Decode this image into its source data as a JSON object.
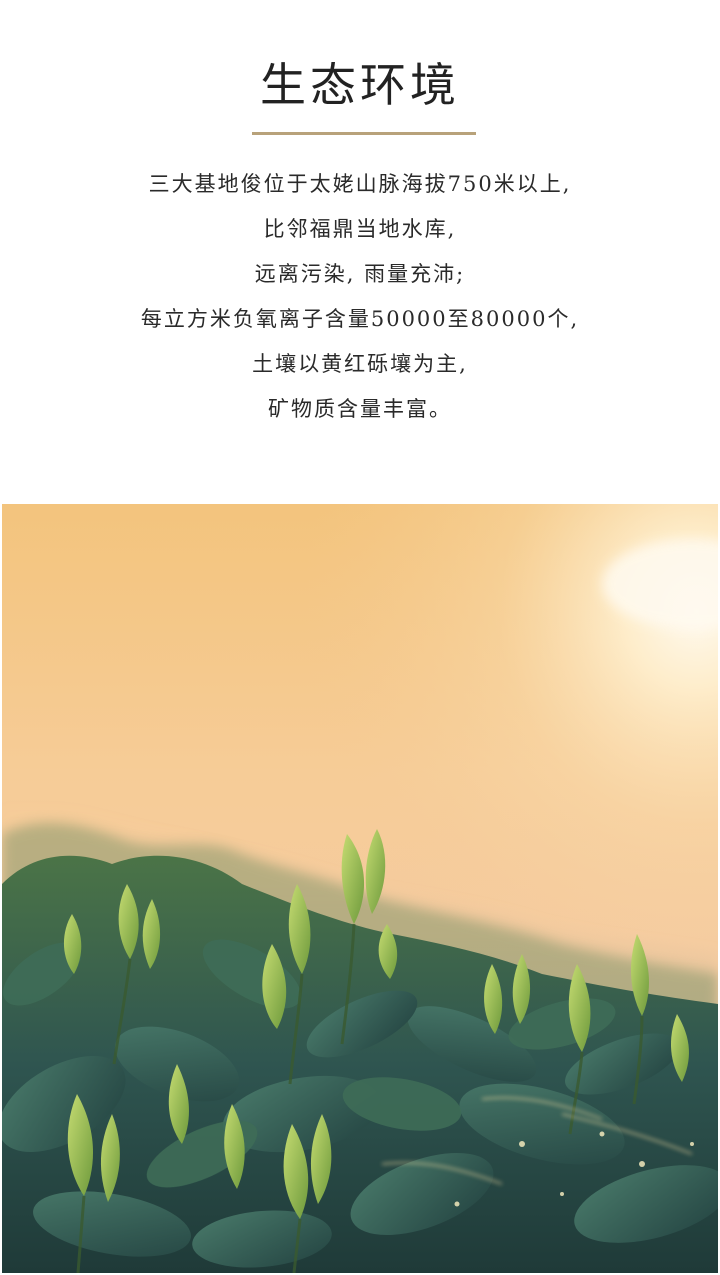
{
  "section": {
    "title": "生态环境",
    "lines": [
      "三大基地俊位于太姥山脉海拔750米以上,",
      "比邻福鼎当地水库,",
      "远离污染, 雨量充沛;",
      "每立方米负氧离子含量50000至80000个,",
      "土壤以黄红砾壤为主,",
      "矿物质含量丰富。"
    ]
  },
  "photo": {
    "subject": "tea-bushes-at-sunrise",
    "colors": {
      "sky_top": "#f4c983",
      "sky_mid": "#f6cfa0",
      "sky_low": "#f3c9a4",
      "sun_glow": "#fff6dd",
      "leaf_dark": "#2f5a55",
      "leaf_mid": "#4f7d3e",
      "leaf_light": "#a6c95b"
    }
  }
}
